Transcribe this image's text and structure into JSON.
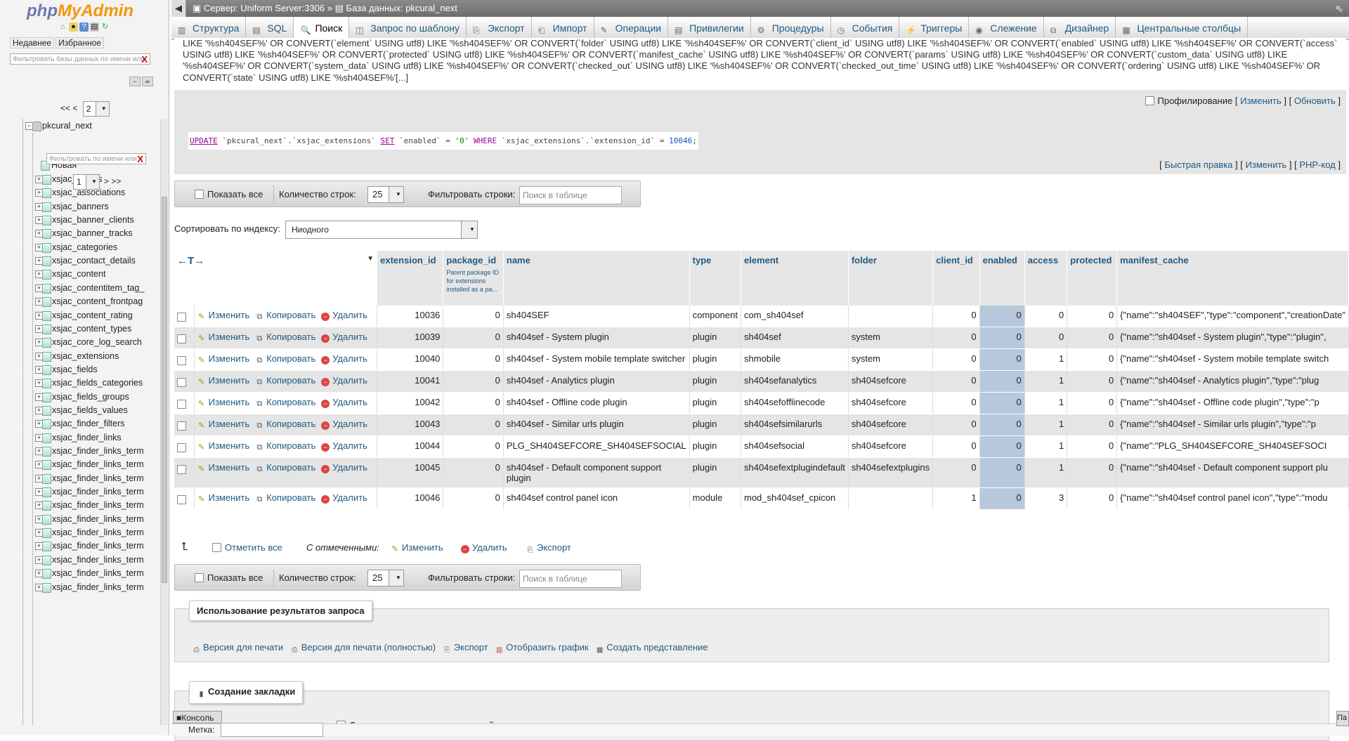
{
  "sidebar": {
    "logo_php": "php",
    "logo_myadmin": "MyAdmin",
    "recent_label": "Недавнее",
    "favorites_label": "Избранное",
    "db_filter_placeholder": "Фильтровать базы данных по имени или",
    "clear_x": "X",
    "pager_prev": "<< <",
    "pager_page": "2",
    "db_items": [
      {
        "label": "pkcural"
      },
      {
        "label": "pkcural_next"
      }
    ],
    "table_filter_placeholder": "Фильтровать по имени или",
    "table_pager_page": "1",
    "table_pager_next": "> >>",
    "new_label": "Новая",
    "tables": [
      "xsjac_assets",
      "xsjac_associations",
      "xsjac_banners",
      "xsjac_banner_clients",
      "xsjac_banner_tracks",
      "xsjac_categories",
      "xsjac_contact_details",
      "xsjac_content",
      "xsjac_contentitem_tag_",
      "xsjac_content_frontpag",
      "xsjac_content_rating",
      "xsjac_content_types",
      "xsjac_core_log_search",
      "xsjac_extensions",
      "xsjac_fields",
      "xsjac_fields_categories",
      "xsjac_fields_groups",
      "xsjac_fields_values",
      "xsjac_finder_filters",
      "xsjac_finder_links",
      "xsjac_finder_links_term",
      "xsjac_finder_links_term",
      "xsjac_finder_links_term",
      "xsjac_finder_links_term",
      "xsjac_finder_links_term",
      "xsjac_finder_links_term",
      "xsjac_finder_links_term",
      "xsjac_finder_links_term",
      "xsjac_finder_links_term",
      "xsjac_finder_links_term",
      "xsjac_finder_links_term"
    ]
  },
  "topbar": {
    "server": "Сервер: Uniform Server:3306",
    "sep": "»",
    "database": "База данных: pkcural_next"
  },
  "tabs": [
    {
      "label": "Структура",
      "icon": "structure-icon"
    },
    {
      "label": "SQL",
      "icon": "sql-icon"
    },
    {
      "label": "Поиск",
      "icon": "search-icon",
      "active": true
    },
    {
      "label": "Запрос по шаблону",
      "icon": "query-icon"
    },
    {
      "label": "Экспорт",
      "icon": "export-icon"
    },
    {
      "label": "Импорт",
      "icon": "import-icon"
    },
    {
      "label": "Операции",
      "icon": "operations-icon"
    },
    {
      "label": "Привилегии",
      "icon": "privileges-icon"
    },
    {
      "label": "Процедуры",
      "icon": "routines-icon"
    },
    {
      "label": "События",
      "icon": "events-icon"
    },
    {
      "label": "Триггеры",
      "icon": "triggers-icon"
    },
    {
      "label": "Слежение",
      "icon": "tracking-icon"
    },
    {
      "label": "Дизайнер",
      "icon": "designer-icon"
    },
    {
      "label": "Центральные столбцы",
      "icon": "central-columns-icon"
    }
  ],
  "query_text": "LIKE '%sh404SEF%' OR CONVERT(`element` USING utf8) LIKE '%sh404SEF%' OR CONVERT(`folder` USING utf8) LIKE '%sh404SEF%' OR CONVERT(`client_id` USING utf8) LIKE '%sh404SEF%' OR CONVERT(`enabled` USING utf8) LIKE '%sh404SEF%' OR CONVERT(`access` USING utf8) LIKE '%sh404SEF%' OR CONVERT(`protected` USING utf8) LIKE '%sh404SEF%' OR CONVERT(`manifest_cache` USING utf8) LIKE '%sh404SEF%' OR CONVERT(`params` USING utf8) LIKE '%sh404SEF%' OR CONVERT(`custom_data` USING utf8) LIKE '%sh404SEF%' OR CONVERT(`system_data` USING utf8) LIKE '%sh404SEF%' OR CONVERT(`checked_out` USING utf8) LIKE '%sh404SEF%' OR CONVERT(`checked_out_time` USING utf8) LIKE '%sh404SEF%' OR CONVERT(`ordering` USING utf8) LIKE '%sh404SEF%' OR CONVERT(`state` USING utf8) LIKE '%sh404SEF%'[...]",
  "profiling": {
    "label": "Профилирование",
    "edit": "Изменить",
    "refresh": "Обновить",
    "open": "[",
    "close": "]"
  },
  "update_sql": {
    "kw_update": "UPDATE",
    "table": " `pkcural_next`.`xsjac_extensions` ",
    "kw_set": "SET",
    "assign": " `enabled` = ",
    "val": "'0'",
    "kw_where": " WHERE ",
    "cond": "`xsjac_extensions`.`extension_id` = ",
    "id": "10046",
    "end": ";",
    "quick_edit": "Быстрая правка",
    "edit": "Изменить",
    "php_code": "PHP-код"
  },
  "nav": {
    "show_all": "Показать все",
    "rows_label": "Количество строк:",
    "rows_value": "25",
    "filter_label": "Фильтровать строки:",
    "filter_placeholder": "Поиск в таблице"
  },
  "sort": {
    "label": "Сортировать по индексу:",
    "value": "Ниодного"
  },
  "table": {
    "arrows": "←T→",
    "headers": [
      "extension_id",
      "package_id",
      "name",
      "type",
      "element",
      "folder",
      "client_id",
      "enabled",
      "access",
      "protected",
      "manifest_cache"
    ],
    "package_comment": "Parent package ID for extensions installed as a pa...",
    "action_edit": "Изменить",
    "action_copy": "Копировать",
    "action_delete": "Удалить",
    "rows": [
      {
        "extension_id": "10036",
        "package_id": "0",
        "name": "sh404SEF",
        "type": "component",
        "element": "com_sh404sef",
        "folder": "",
        "client_id": "0",
        "enabled": "0",
        "access": "0",
        "protected": "0",
        "manifest_cache": "{\"name\":\"sh404SEF\",\"type\":\"component\",\"creationDate\""
      },
      {
        "extension_id": "10039",
        "package_id": "0",
        "name": "sh404sef - System plugin",
        "type": "plugin",
        "element": "sh404sef",
        "folder": "system",
        "client_id": "0",
        "enabled": "0",
        "access": "0",
        "protected": "0",
        "manifest_cache": "{\"name\":\"sh404sef - System plugin\",\"type\":\"plugin\","
      },
      {
        "extension_id": "10040",
        "package_id": "0",
        "name": "sh404sef - System mobile template switcher",
        "type": "plugin",
        "element": "shmobile",
        "folder": "system",
        "client_id": "0",
        "enabled": "0",
        "access": "1",
        "protected": "0",
        "manifest_cache": "{\"name\":\"sh404sef - System mobile template switch"
      },
      {
        "extension_id": "10041",
        "package_id": "0",
        "name": "sh404sef - Analytics plugin",
        "type": "plugin",
        "element": "sh404sefanalytics",
        "folder": "sh404sefcore",
        "client_id": "0",
        "enabled": "0",
        "access": "1",
        "protected": "0",
        "manifest_cache": "{\"name\":\"sh404sef - Analytics plugin\",\"type\":\"plug"
      },
      {
        "extension_id": "10042",
        "package_id": "0",
        "name": "sh404sef - Offline code plugin",
        "type": "plugin",
        "element": "sh404sefofflinecode",
        "folder": "sh404sefcore",
        "client_id": "0",
        "enabled": "0",
        "access": "1",
        "protected": "0",
        "manifest_cache": "{\"name\":\"sh404sef - Offline code plugin\",\"type\":\"p"
      },
      {
        "extension_id": "10043",
        "package_id": "0",
        "name": "sh404sef - Similar urls plugin",
        "type": "plugin",
        "element": "sh404sefsimilarurls",
        "folder": "sh404sefcore",
        "client_id": "0",
        "enabled": "0",
        "access": "1",
        "protected": "0",
        "manifest_cache": "{\"name\":\"sh404sef - Similar urls plugin\",\"type\":\"p"
      },
      {
        "extension_id": "10044",
        "package_id": "0",
        "name": "PLG_SH404SEFCORE_SH404SEFSOCIAL",
        "type": "plugin",
        "element": "sh404sefsocial",
        "folder": "sh404sefcore",
        "client_id": "0",
        "enabled": "0",
        "access": "1",
        "protected": "0",
        "manifest_cache": "{\"name\":\"PLG_SH404SEFCORE_SH404SEFSOCI"
      },
      {
        "extension_id": "10045",
        "package_id": "0",
        "name": "sh404sef - Default component support plugin",
        "type": "plugin",
        "element": "sh404sefextplugindefault",
        "folder": "sh404sefextplugins",
        "client_id": "0",
        "enabled": "0",
        "access": "1",
        "protected": "0",
        "manifest_cache": "{\"name\":\"sh404sef - Default component support plu"
      },
      {
        "extension_id": "10046",
        "package_id": "0",
        "name": "sh404sef control panel icon",
        "type": "module",
        "element": "mod_sh404sef_cpicon",
        "folder": "",
        "client_id": "1",
        "enabled": "0",
        "access": "3",
        "protected": "0",
        "manifest_cache": "{\"name\":\"sh404sef control panel icon\",\"type\":\"modu"
      }
    ]
  },
  "with_selected": {
    "check_all": "Отметить все",
    "label": "С отмеченными:",
    "edit": "Изменить",
    "delete": "Удалить",
    "export": "Экспорт"
  },
  "query_results": {
    "legend": "Использование результатов запроса",
    "print": "Версия для печати",
    "print_full": "Версия для печати (полностью)",
    "export": "Экспорт",
    "chart": "Отобразить график",
    "create_view": "Создать представление"
  },
  "bookmark": {
    "legend": "Создание закладки",
    "label": "Метка:",
    "public": "Доступна для всех пользователей"
  },
  "console": "Консоль",
  "right_tab": "Па",
  "colors": {
    "accent": "#235a81",
    "enabled_highlight": "#b8c8dc"
  }
}
